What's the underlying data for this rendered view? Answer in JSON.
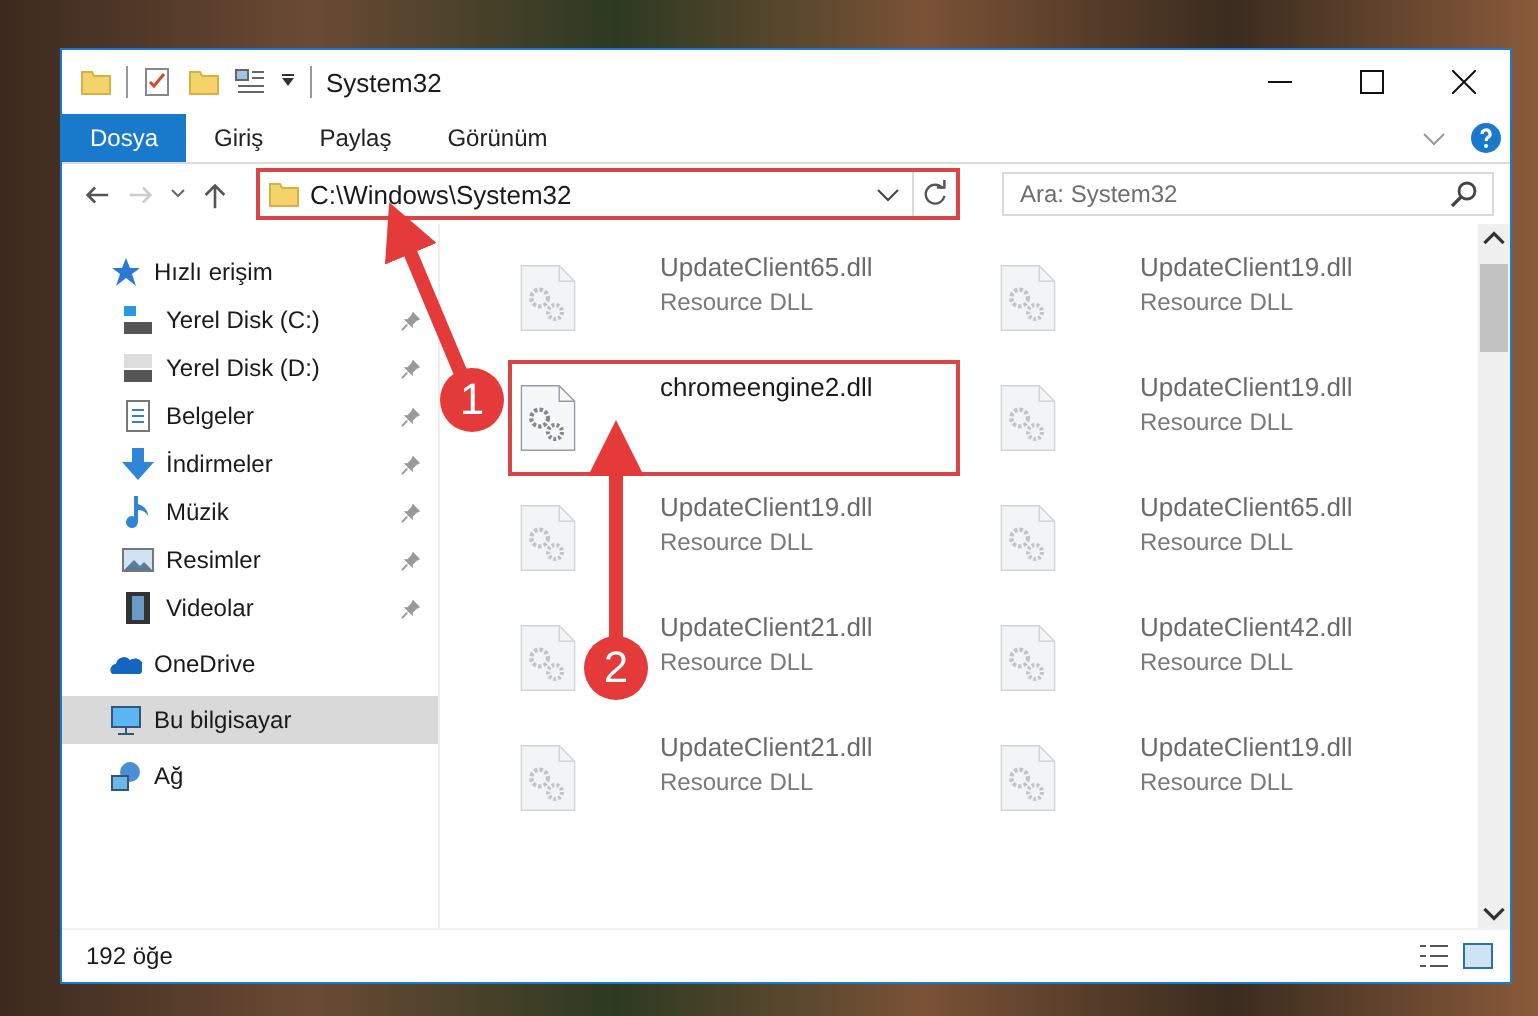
{
  "window": {
    "title": "System32"
  },
  "ribbon_tabs": [
    {
      "label": "Dosya",
      "selected": true
    },
    {
      "label": "Giriş",
      "selected": false
    },
    {
      "label": "Paylaş",
      "selected": false
    },
    {
      "label": "Görünüm",
      "selected": false
    }
  ],
  "address": {
    "path": "C:\\Windows\\System32",
    "highlighted": true
  },
  "search": {
    "placeholder": "Ara: System32"
  },
  "sidebar": {
    "items": [
      {
        "label": "Hızlı erişim",
        "selected": false,
        "children": [
          {
            "label": "Yerel Disk (C:)",
            "pinned": true
          },
          {
            "label": "Yerel Disk (D:)",
            "pinned": true
          },
          {
            "label": "Belgeler",
            "pinned": true
          },
          {
            "label": "İndirmeler",
            "pinned": true
          },
          {
            "label": "Müzik",
            "pinned": true
          },
          {
            "label": "Resimler",
            "pinned": true
          },
          {
            "label": "Videolar",
            "pinned": true
          }
        ]
      },
      {
        "label": "OneDrive",
        "selected": false
      },
      {
        "label": "Bu bilgisayar",
        "selected": true
      },
      {
        "label": "Ağ",
        "selected": false
      }
    ]
  },
  "files": [
    {
      "name": "UpdateClient65.dll",
      "type": "Resource DLL",
      "dimmed": true,
      "highlighted": false
    },
    {
      "name": "UpdateClient19.dll",
      "type": "Resource DLL",
      "dimmed": true,
      "highlighted": false
    },
    {
      "name": "chromeengine2.dll",
      "dimmed": false,
      "highlighted": true
    },
    {
      "name": "UpdateClient19.dll",
      "type": "Resource DLL",
      "dimmed": true,
      "highlighted": false
    },
    {
      "name": "UpdateClient19.dll",
      "type": "Resource DLL",
      "dimmed": true,
      "highlighted": false
    },
    {
      "name": "UpdateClient65.dll",
      "type": "Resource DLL",
      "dimmed": true,
      "highlighted": false
    },
    {
      "name": "UpdateClient21.dll",
      "type": "Resource DLL",
      "dimmed": true,
      "highlighted": false
    },
    {
      "name": "UpdateClient42.dll",
      "type": "Resource DLL",
      "dimmed": true,
      "highlighted": false
    },
    {
      "name": "UpdateClient21.dll",
      "type": "Resource DLL",
      "dimmed": true,
      "highlighted": false
    },
    {
      "name": "UpdateClient19.dll",
      "type": "Resource DLL",
      "dimmed": true,
      "highlighted": false
    }
  ],
  "status_bar": {
    "item_count": "192 öğe"
  },
  "annotations": [
    {
      "number": "1"
    },
    {
      "number": "2"
    }
  ]
}
